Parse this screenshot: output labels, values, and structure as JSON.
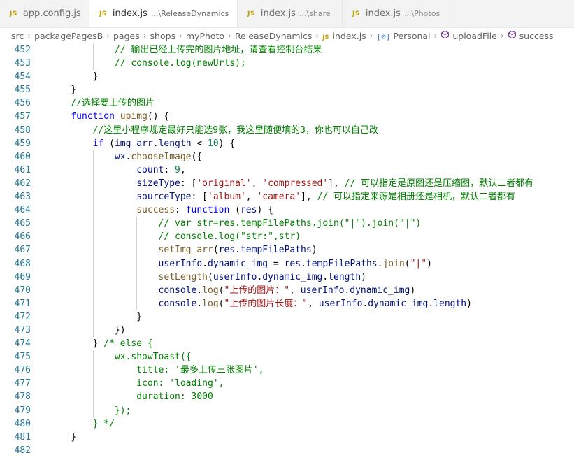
{
  "tabs": [
    {
      "badge": "JS",
      "label": "app.config.js",
      "desc": "",
      "active": false,
      "dirty": false
    },
    {
      "badge": "JS",
      "label": "index.js",
      "desc": "...\\ReleaseDynamics",
      "active": true,
      "dirty": true
    },
    {
      "badge": "JS",
      "label": "index.js",
      "desc": "...\\share",
      "active": false,
      "dirty": false
    },
    {
      "badge": "JS",
      "label": "index.js",
      "desc": "...\\Photos",
      "active": false,
      "dirty": false
    }
  ],
  "breadcrumb": {
    "path": [
      "src",
      "packagePagesB",
      "pages",
      "shops",
      "myPhoto",
      "ReleaseDynamics"
    ],
    "file_badge": "JS",
    "file": "index.js",
    "symbols": [
      {
        "icon": "variable-icon",
        "label": "Personal"
      },
      {
        "icon": "method-icon",
        "label": "uploadFile"
      },
      {
        "icon": "method-icon",
        "label": "success"
      }
    ]
  },
  "editor": {
    "lines": [
      {
        "n": "452",
        "indent": 3,
        "tokens": [
          [
            "c",
            "// 输出已经上传完的图片地址，请查看控制台结果"
          ]
        ]
      },
      {
        "n": "453",
        "indent": 3,
        "tokens": [
          [
            "c",
            "// console.log(newUrls);"
          ]
        ]
      },
      {
        "n": "454",
        "indent": 2,
        "tokens": [
          [
            "p",
            "}"
          ]
        ]
      },
      {
        "n": "455",
        "indent": 1,
        "tokens": [
          [
            "p",
            "}"
          ]
        ]
      },
      {
        "n": "456",
        "indent": 1,
        "tokens": [
          [
            "c",
            "//选择要上传的图片"
          ]
        ]
      },
      {
        "n": "457",
        "indent": 1,
        "tokens": [
          [
            "k",
            "function"
          ],
          [
            "p",
            " "
          ],
          [
            "f",
            "upimg"
          ],
          [
            "p",
            "() {"
          ]
        ]
      },
      {
        "n": "458",
        "indent": 2,
        "tokens": [
          [
            "c",
            "//这里小程序规定最好只能选9张，我这里随便填的3，你也可以自己改"
          ]
        ]
      },
      {
        "n": "459",
        "indent": 2,
        "tokens": [
          [
            "k",
            "if"
          ],
          [
            "p",
            " ("
          ],
          [
            "v",
            "img_arr"
          ],
          [
            "p",
            "."
          ],
          [
            "v",
            "length"
          ],
          [
            "p",
            " < "
          ],
          [
            "n",
            "10"
          ],
          [
            "p",
            ") {"
          ]
        ]
      },
      {
        "n": "460",
        "indent": 3,
        "tokens": [
          [
            "v",
            "wx"
          ],
          [
            "p",
            "."
          ],
          [
            "f",
            "chooseImage"
          ],
          [
            "p",
            "({"
          ]
        ]
      },
      {
        "n": "461",
        "indent": 4,
        "tokens": [
          [
            "v",
            "count"
          ],
          [
            "p",
            ": "
          ],
          [
            "n",
            "9"
          ],
          [
            "p",
            ","
          ]
        ]
      },
      {
        "n": "462",
        "indent": 4,
        "tokens": [
          [
            "v",
            "sizeType"
          ],
          [
            "p",
            ": ["
          ],
          [
            "s",
            "'original'"
          ],
          [
            "p",
            ", "
          ],
          [
            "s",
            "'compressed'"
          ],
          [
            "p",
            "], "
          ],
          [
            "c",
            "// 可以指定是原图还是压缩图，默认二者都有"
          ]
        ]
      },
      {
        "n": "463",
        "indent": 4,
        "tokens": [
          [
            "v",
            "sourceType"
          ],
          [
            "p",
            ": ["
          ],
          [
            "s",
            "'album'"
          ],
          [
            "p",
            ", "
          ],
          [
            "s",
            "'camera'"
          ],
          [
            "p",
            "], "
          ],
          [
            "c",
            "// 可以指定来源是相册还是相机，默认二者都有"
          ]
        ]
      },
      {
        "n": "464",
        "indent": 4,
        "tokens": [
          [
            "f",
            "success"
          ],
          [
            "p",
            ": "
          ],
          [
            "k",
            "function"
          ],
          [
            "p",
            " ("
          ],
          [
            "v",
            "res"
          ],
          [
            "p",
            ") {"
          ]
        ]
      },
      {
        "n": "465",
        "indent": 5,
        "tokens": [
          [
            "c",
            "// var str=res.tempFilePaths.join(\"|\").join(\"|\")"
          ]
        ]
      },
      {
        "n": "466",
        "indent": 5,
        "tokens": [
          [
            "c",
            "// console.log(\"str:\",str)"
          ]
        ]
      },
      {
        "n": "467",
        "indent": 5,
        "tokens": [
          [
            "f",
            "setImg_arr"
          ],
          [
            "p",
            "("
          ],
          [
            "v",
            "res"
          ],
          [
            "p",
            "."
          ],
          [
            "v",
            "tempFilePaths"
          ],
          [
            "p",
            ")"
          ]
        ]
      },
      {
        "n": "468",
        "indent": 5,
        "tokens": [
          [
            "v",
            "userInfo"
          ],
          [
            "p",
            "."
          ],
          [
            "v",
            "dynamic_img"
          ],
          [
            "p",
            " = "
          ],
          [
            "v",
            "res"
          ],
          [
            "p",
            "."
          ],
          [
            "v",
            "tempFilePaths"
          ],
          [
            "p",
            "."
          ],
          [
            "f",
            "join"
          ],
          [
            "p",
            "("
          ],
          [
            "s",
            "\"|\""
          ],
          [
            "p",
            ")"
          ]
        ]
      },
      {
        "n": "469",
        "indent": 5,
        "tokens": [
          [
            "f",
            "setLength"
          ],
          [
            "p",
            "("
          ],
          [
            "v",
            "userInfo"
          ],
          [
            "p",
            "."
          ],
          [
            "v",
            "dynamic_img"
          ],
          [
            "p",
            "."
          ],
          [
            "v",
            "length"
          ],
          [
            "p",
            ")"
          ]
        ]
      },
      {
        "n": "470",
        "indent": 5,
        "tokens": [
          [
            "v",
            "console"
          ],
          [
            "p",
            "."
          ],
          [
            "f",
            "log"
          ],
          [
            "p",
            "("
          ],
          [
            "s",
            "\"上传的图片：\""
          ],
          [
            "p",
            ", "
          ],
          [
            "v",
            "userInfo"
          ],
          [
            "p",
            "."
          ],
          [
            "v",
            "dynamic_img"
          ],
          [
            "p",
            ")"
          ]
        ]
      },
      {
        "n": "471",
        "indent": 5,
        "tokens": [
          [
            "v",
            "console"
          ],
          [
            "p",
            "."
          ],
          [
            "f",
            "log"
          ],
          [
            "p",
            "("
          ],
          [
            "s",
            "\"上传的图片长度：\""
          ],
          [
            "p",
            ", "
          ],
          [
            "v",
            "userInfo"
          ],
          [
            "p",
            "."
          ],
          [
            "v",
            "dynamic_img"
          ],
          [
            "p",
            "."
          ],
          [
            "v",
            "length"
          ],
          [
            "p",
            ")"
          ]
        ]
      },
      {
        "n": "472",
        "indent": 4,
        "tokens": [
          [
            "p",
            "}"
          ]
        ]
      },
      {
        "n": "473",
        "indent": 3,
        "tokens": [
          [
            "p",
            "})"
          ]
        ]
      },
      {
        "n": "474",
        "indent": 2,
        "tokens": [
          [
            "p",
            "} "
          ],
          [
            "c",
            "/* else {"
          ]
        ]
      },
      {
        "n": "475",
        "indent": 3,
        "tokens": [
          [
            "c",
            "wx.showToast({"
          ]
        ]
      },
      {
        "n": "476",
        "indent": 4,
        "tokens": [
          [
            "c",
            "title: '最多上传三张图片',"
          ]
        ]
      },
      {
        "n": "477",
        "indent": 4,
        "tokens": [
          [
            "c",
            "icon: 'loading',"
          ]
        ]
      },
      {
        "n": "478",
        "indent": 4,
        "tokens": [
          [
            "c",
            "duration: 3000"
          ]
        ]
      },
      {
        "n": "479",
        "indent": 3,
        "tokens": [
          [
            "c",
            "});"
          ]
        ]
      },
      {
        "n": "480",
        "indent": 2,
        "tokens": [
          [
            "c",
            "} */"
          ]
        ]
      },
      {
        "n": "481",
        "indent": 1,
        "tokens": [
          [
            "p",
            "}"
          ]
        ]
      },
      {
        "n": "482",
        "indent": 0,
        "tokens": []
      }
    ]
  }
}
